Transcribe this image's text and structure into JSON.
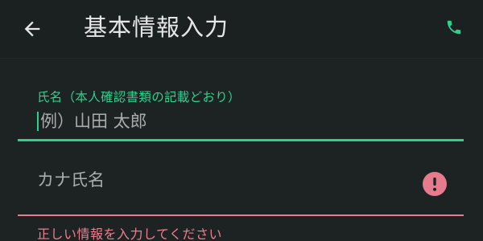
{
  "header": {
    "title": "基本情報入力",
    "back_icon": "arrow-left-icon",
    "call_icon": "phone-icon"
  },
  "form": {
    "name_field": {
      "label": "氏名（本人確認書類の記載どおり）",
      "placeholder": "例）山田 太郎",
      "value": ""
    },
    "kana_field": {
      "placeholder": "カナ氏名",
      "value": "",
      "error_icon": "exclamation-icon",
      "error_message": "正しい情報を入力してください"
    }
  },
  "colors": {
    "background": "#1c2322",
    "accent": "#2fd08e",
    "error": "#e57b8c",
    "text": "#e6e6e6"
  }
}
